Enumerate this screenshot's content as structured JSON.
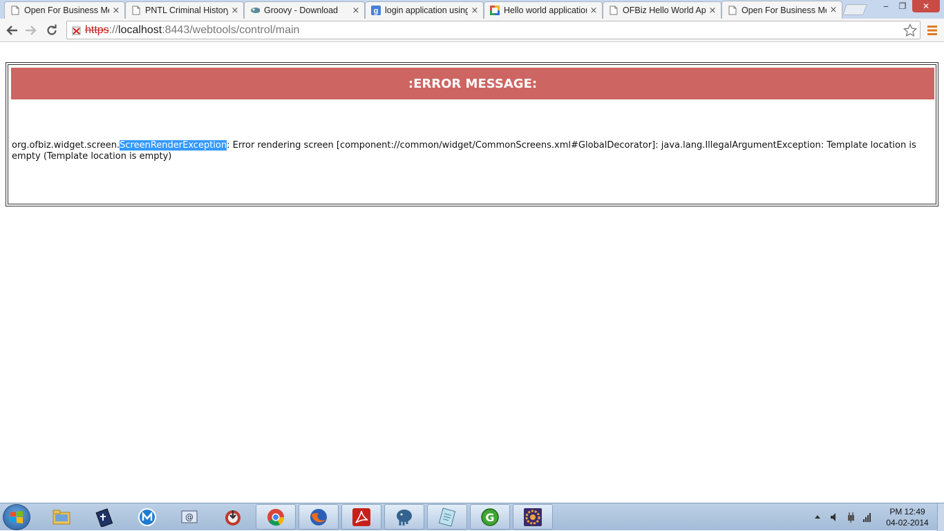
{
  "browser": {
    "tabs": [
      {
        "title": "Open For Business Me",
        "favicon": "page-icon"
      },
      {
        "title": "PNTL Criminal History",
        "favicon": "page-icon"
      },
      {
        "title": "Groovy - Download",
        "favicon": "groovy-icon"
      },
      {
        "title": "login application using",
        "favicon": "google-icon"
      },
      {
        "title": "Hello world application",
        "favicon": "colorful-icon"
      },
      {
        "title": "OFBiz Hello World Ap",
        "favicon": "page-icon"
      },
      {
        "title": "Open For Business Me",
        "favicon": "page-icon"
      }
    ],
    "active_tab_index": 6,
    "tab_close_glyph": "×",
    "url": {
      "protocol": "https",
      "separator": "://",
      "host": "localhost",
      "path": ":8443/webtools/control/main"
    },
    "window_controls": {
      "minimize": "‒",
      "restore": "❐",
      "close": "✕"
    }
  },
  "page": {
    "header": ":ERROR MESSAGE:",
    "message_prefix": "org.ofbiz.widget.screen.",
    "message_selected": "ScreenRenderException",
    "message_suffix": ": Error rendering screen [component://common/widget/CommonScreens.xml#GlobalDecorator]: java.lang.IllegalArgumentException: Template location is empty (Template location is empty)",
    "colors": {
      "header_bg": "#cd6562",
      "selection": "#3399ff"
    }
  },
  "taskbar": {
    "items": [
      {
        "name": "windows-explorer",
        "running": false
      },
      {
        "name": "bible-app",
        "running": false
      },
      {
        "name": "maxthon",
        "running": false
      },
      {
        "name": "email-app",
        "running": false
      },
      {
        "name": "download-manager",
        "running": false
      },
      {
        "name": "chrome",
        "running": true
      },
      {
        "name": "firefox",
        "running": true
      },
      {
        "name": "adobe-reader",
        "running": true
      },
      {
        "name": "postgresql",
        "running": true
      },
      {
        "name": "notepad",
        "running": true
      },
      {
        "name": "groovy-console",
        "running": true
      },
      {
        "name": "java-ee-ide",
        "running": true
      }
    ],
    "clock": {
      "time": "PM 12:49",
      "date": "04-02-2014"
    }
  }
}
